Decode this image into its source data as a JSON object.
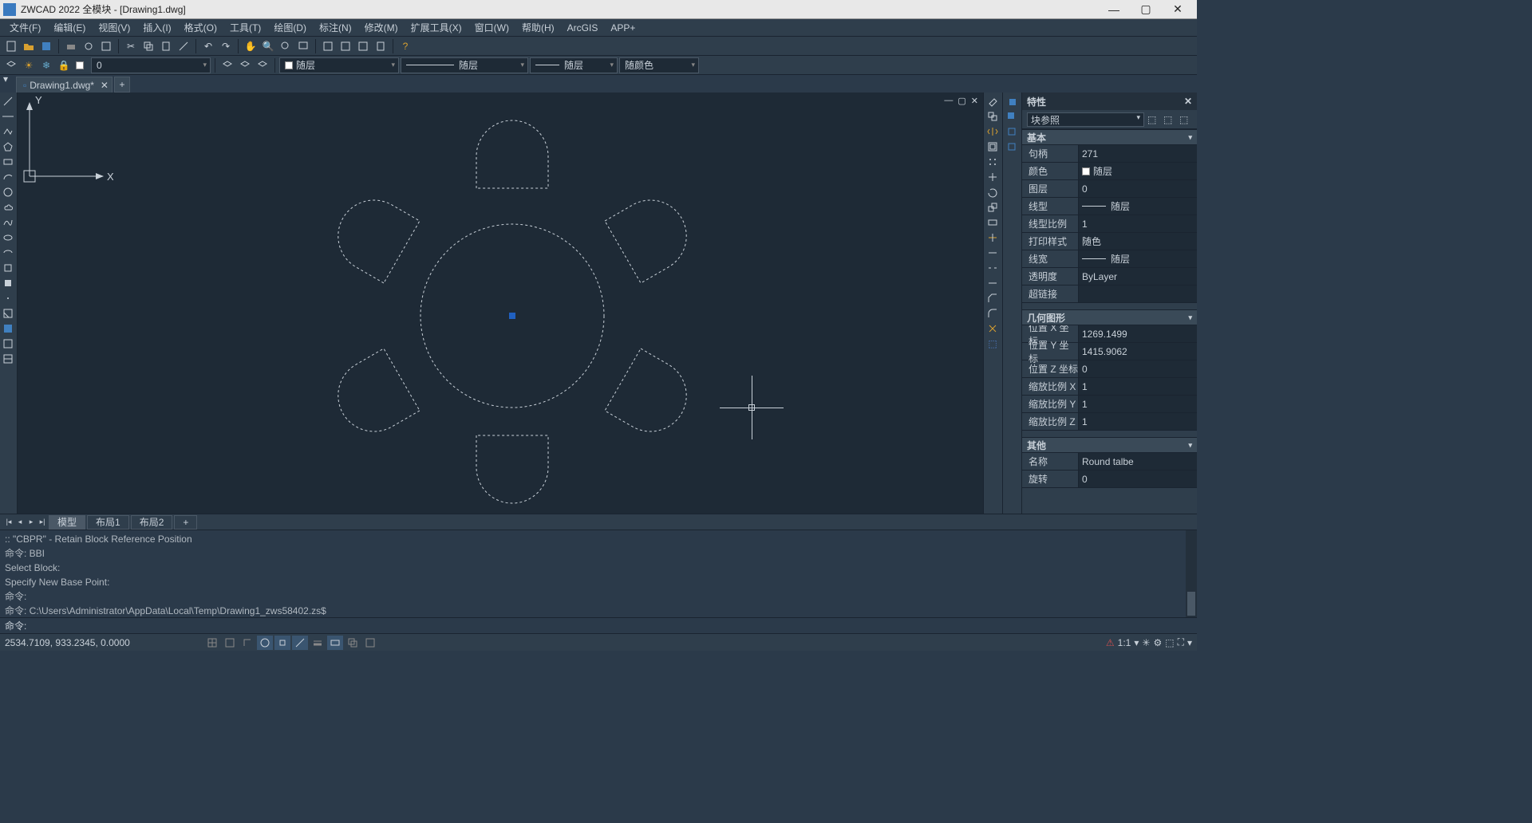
{
  "title": "ZWCAD 2022 全模块 - [Drawing1.dwg]",
  "menus": [
    "文件(F)",
    "编辑(E)",
    "视图(V)",
    "插入(I)",
    "格式(O)",
    "工具(T)",
    "绘图(D)",
    "标注(N)",
    "修改(M)",
    "扩展工具(X)",
    "窗口(W)",
    "帮助(H)",
    "ArcGIS",
    "APP+"
  ],
  "layerbar": {
    "layer_label": "随层",
    "lt_label": "随层",
    "lw_label": "随层",
    "color_label": "随颜色",
    "current_layer": "0"
  },
  "filetab": "Drawing1.dwg*",
  "layout_tabs": [
    "模型",
    "布局1",
    "布局2"
  ],
  "cmd_history": [
    "::   \"CBPR\" -  Retain Block Reference Position",
    "命令: BBI",
    "Select Block:",
    "Specify New Base Point:",
    "命令:",
    "命令: C:\\Users\\Administrator\\AppData\\Local\\Temp\\Drawing1_zws58402.zs$"
  ],
  "cmd_prompt": "命令:",
  "status": {
    "coords": "2534.7109, 933.2345, 0.0000",
    "scale": "1:1"
  },
  "properties": {
    "title": "特性",
    "selection": "块参照",
    "sections": {
      "basic": "基本",
      "geom": "几何图形",
      "other": "其他"
    },
    "basic": [
      {
        "k": "句柄",
        "v": "271"
      },
      {
        "k": "颜色",
        "v": "随层",
        "color": true
      },
      {
        "k": "图层",
        "v": "0"
      },
      {
        "k": "线型",
        "v": "随层",
        "line": true
      },
      {
        "k": "线型比例",
        "v": "1"
      },
      {
        "k": "打印样式",
        "v": "随色"
      },
      {
        "k": "线宽",
        "v": "随层",
        "line": true
      },
      {
        "k": "透明度",
        "v": "ByLayer"
      },
      {
        "k": "超链接",
        "v": ""
      }
    ],
    "geom": [
      {
        "k": "位置 X 坐标",
        "v": "1269.1499"
      },
      {
        "k": "位置 Y 坐标",
        "v": "1415.9062"
      },
      {
        "k": "位置 Z 坐标",
        "v": "0"
      },
      {
        "k": "缩放比例 X",
        "v": "1"
      },
      {
        "k": "缩放比例 Y",
        "v": "1"
      },
      {
        "k": "缩放比例 Z",
        "v": "1"
      }
    ],
    "other": [
      {
        "k": "名称",
        "v": "Round talbe"
      },
      {
        "k": "旋转",
        "v": "0"
      }
    ]
  },
  "ucs": {
    "x": "X",
    "y": "Y"
  }
}
